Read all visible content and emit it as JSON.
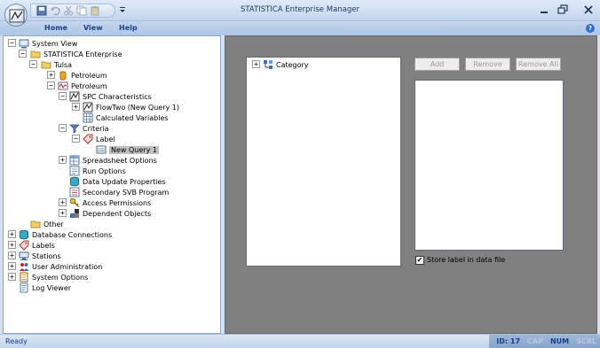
{
  "window": {
    "title": "STATISTICA Enterprise Manager",
    "app_icon": "statistica-logo-icon",
    "quick_access": [
      "save-icon",
      "undo-icon",
      "cut-icon",
      "copy-icon",
      "paste-icon"
    ],
    "controls": [
      "minimize-icon",
      "restore-icon",
      "close-icon"
    ]
  },
  "menubar": {
    "items": [
      "Home",
      "View",
      "Help"
    ]
  },
  "tree": {
    "system_view": "System View",
    "enterprise": "STATISTICA Enterprise",
    "tulsa": "Tulsa",
    "petroleum1": "Petroleum",
    "petroleum2": "Petroleum",
    "spc": "SPC Characteristics",
    "flowtwo": "FlowTwo (New Query 1)",
    "calc_vars": "Calculated Variables",
    "criteria": "Criteria",
    "label": "Label",
    "new_query": "New Query 1",
    "spreadsheet_options": "Spreadsheet Options",
    "run_options": "Run Options",
    "data_update": "Data Update Properties",
    "secondary_svb": "Secondary SVB Program",
    "access_permissions": "Access Permissions",
    "dependent_objects": "Dependent Objects",
    "other": "Other",
    "db_connections": "Database Connections",
    "labels": "Labels",
    "stations": "Stations",
    "user_admin": "User Administration",
    "system_options": "System Options",
    "log_viewer": "Log Viewer"
  },
  "right": {
    "category_label": "Category",
    "add": "Add",
    "remove": "Remove",
    "remove_all": "Remove All",
    "store_label": "Store label in data file",
    "store_label_checked": true
  },
  "status": {
    "ready": "Ready",
    "id": "ID: 17",
    "cap": "CAP",
    "num": "NUM",
    "scrl": "SCRL"
  }
}
